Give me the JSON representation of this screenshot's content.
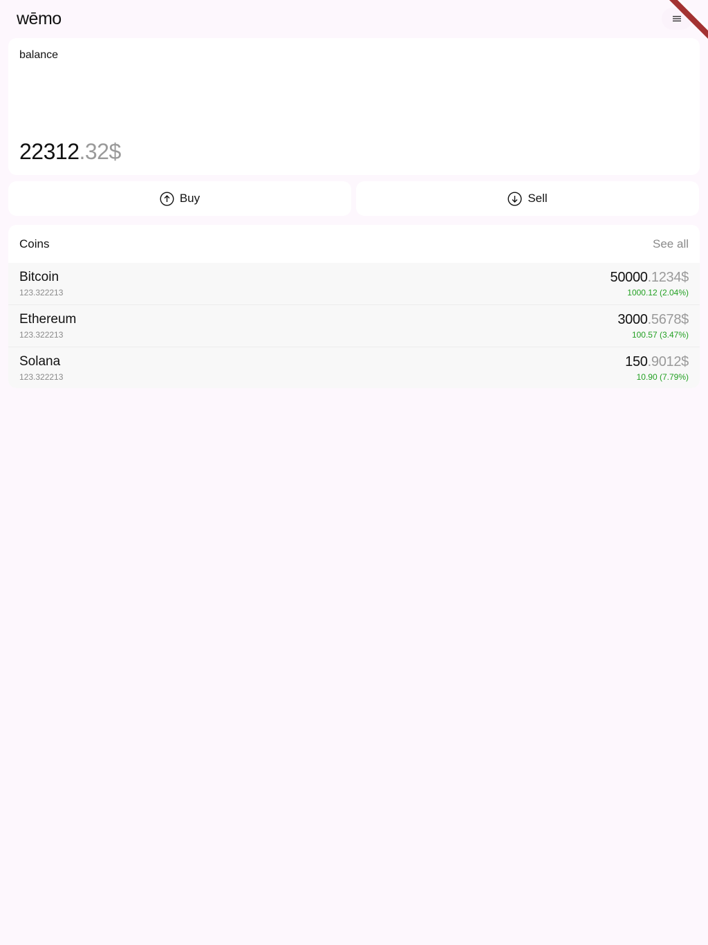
{
  "header": {
    "logo": "wēmo",
    "menu_icon": "hamburger-menu-icon"
  },
  "balance": {
    "label": "balance",
    "integer": "22312",
    "fraction": ".32$"
  },
  "actions": {
    "buy": {
      "label": "Buy",
      "icon": "arrow-up-circle-icon"
    },
    "sell": {
      "label": "Sell",
      "icon": "arrow-down-circle-icon"
    }
  },
  "coins": {
    "title": "Coins",
    "see_all": "See all",
    "items": [
      {
        "name": "Bitcoin",
        "amount": "123.322213",
        "price_int": "50000",
        "price_frac": ".1234$",
        "change": "1000.12 (2.04%)"
      },
      {
        "name": "Ethereum",
        "amount": "123.322213",
        "price_int": "3000",
        "price_frac": ".5678$",
        "change": "100.57 (3.47%)"
      },
      {
        "name": "Solana",
        "amount": "123.322213",
        "price_int": "150",
        "price_frac": ".9012$",
        "change": "10.90 (7.79%)"
      }
    ]
  },
  "colors": {
    "background": "#fdf7fd",
    "card": "#ffffff",
    "positive": "#22a022",
    "muted": "#9a9a9a",
    "debug_ribbon": "#b03030"
  }
}
